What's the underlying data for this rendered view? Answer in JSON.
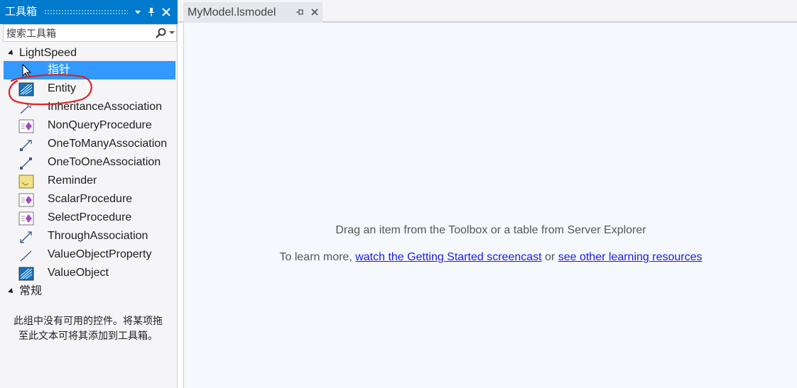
{
  "toolbox": {
    "title": "工具箱",
    "search_placeholder": "搜索工具箱",
    "groups": [
      {
        "name": "LightSpeed",
        "items": [
          {
            "label": "指针",
            "icon": "pointer-icon",
            "selected": true
          },
          {
            "label": "Entity",
            "icon": "entity-icon"
          },
          {
            "label": "InheritanceAssociation",
            "icon": "inheritance-association-icon"
          },
          {
            "label": "NonQueryProcedure",
            "icon": "procedure-icon"
          },
          {
            "label": "OneToManyAssociation",
            "icon": "one-to-many-icon"
          },
          {
            "label": "OneToOneAssociation",
            "icon": "one-to-one-icon"
          },
          {
            "label": "Reminder",
            "icon": "reminder-icon"
          },
          {
            "label": "ScalarProcedure",
            "icon": "procedure-icon"
          },
          {
            "label": "SelectProcedure",
            "icon": "procedure-icon"
          },
          {
            "label": "ThroughAssociation",
            "icon": "through-association-icon"
          },
          {
            "label": "ValueObjectProperty",
            "icon": "value-object-property-icon"
          },
          {
            "label": "ValueObject",
            "icon": "entity-icon"
          }
        ]
      },
      {
        "name": "常规",
        "empty_message": "此组中没有可用的控件。将某项拖至此文本可将其添加到工具箱。"
      }
    ]
  },
  "document": {
    "tab_label": "MyModel.lsmodel",
    "drag_hint": "Drag an item from the Toolbox or a table from Server Explorer",
    "learn_prefix": "To learn more, ",
    "learn_link1": "watch the Getting Started screencast",
    "learn_middle": " or ",
    "learn_link2": "see other learning resources"
  },
  "colors": {
    "accent": "#007acc",
    "selection": "#3399ff",
    "annotation": "#e02020",
    "link": "#1a1ae6"
  }
}
